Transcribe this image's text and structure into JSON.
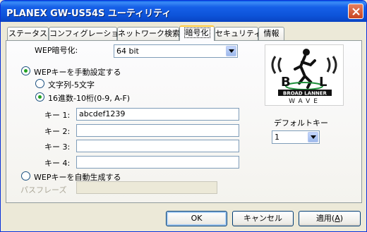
{
  "window": {
    "title": "PLANEX GW-US54S ユーティリティ"
  },
  "tabs": [
    {
      "label": "ステータス"
    },
    {
      "label": "コンフィグレーション"
    },
    {
      "label": "ネットワーク検索"
    },
    {
      "label": "暗号化"
    },
    {
      "label": "セキュリティ"
    },
    {
      "label": "情報"
    }
  ],
  "wep": {
    "label": "WEP暗号化:",
    "selected": "64 bit"
  },
  "manual": {
    "label": "WEPキーを手動設定する",
    "ascii_label": "文字列-5文字",
    "hex_label": "16進数-10桁(0-9, A-F)"
  },
  "keys": [
    {
      "label": "キー 1:",
      "value": "abcdef1239"
    },
    {
      "label": "キー 2:",
      "value": ""
    },
    {
      "label": "キー 3:",
      "value": ""
    },
    {
      "label": "キー 4:",
      "value": ""
    }
  ],
  "auto": {
    "label": "WEPキーを自動生成する",
    "passphrase_label": "パスフレーズ",
    "passphrase_value": ""
  },
  "default_key": {
    "label": "デフォルトキー",
    "selected": "1"
  },
  "logo": {
    "line1": "BROAD LANNER",
    "line2": "WAVE",
    "left": "B",
    "right": "L"
  },
  "buttons": {
    "ok": "OK",
    "cancel": "キャンセル",
    "apply": "適用(",
    "apply_key": "A",
    "apply_end": ")"
  },
  "colors": {
    "titlebar": "#0d54d9",
    "face": "#ece9d8",
    "radio_dot": "#21a121",
    "tab_highlight": "#ffc83c"
  }
}
